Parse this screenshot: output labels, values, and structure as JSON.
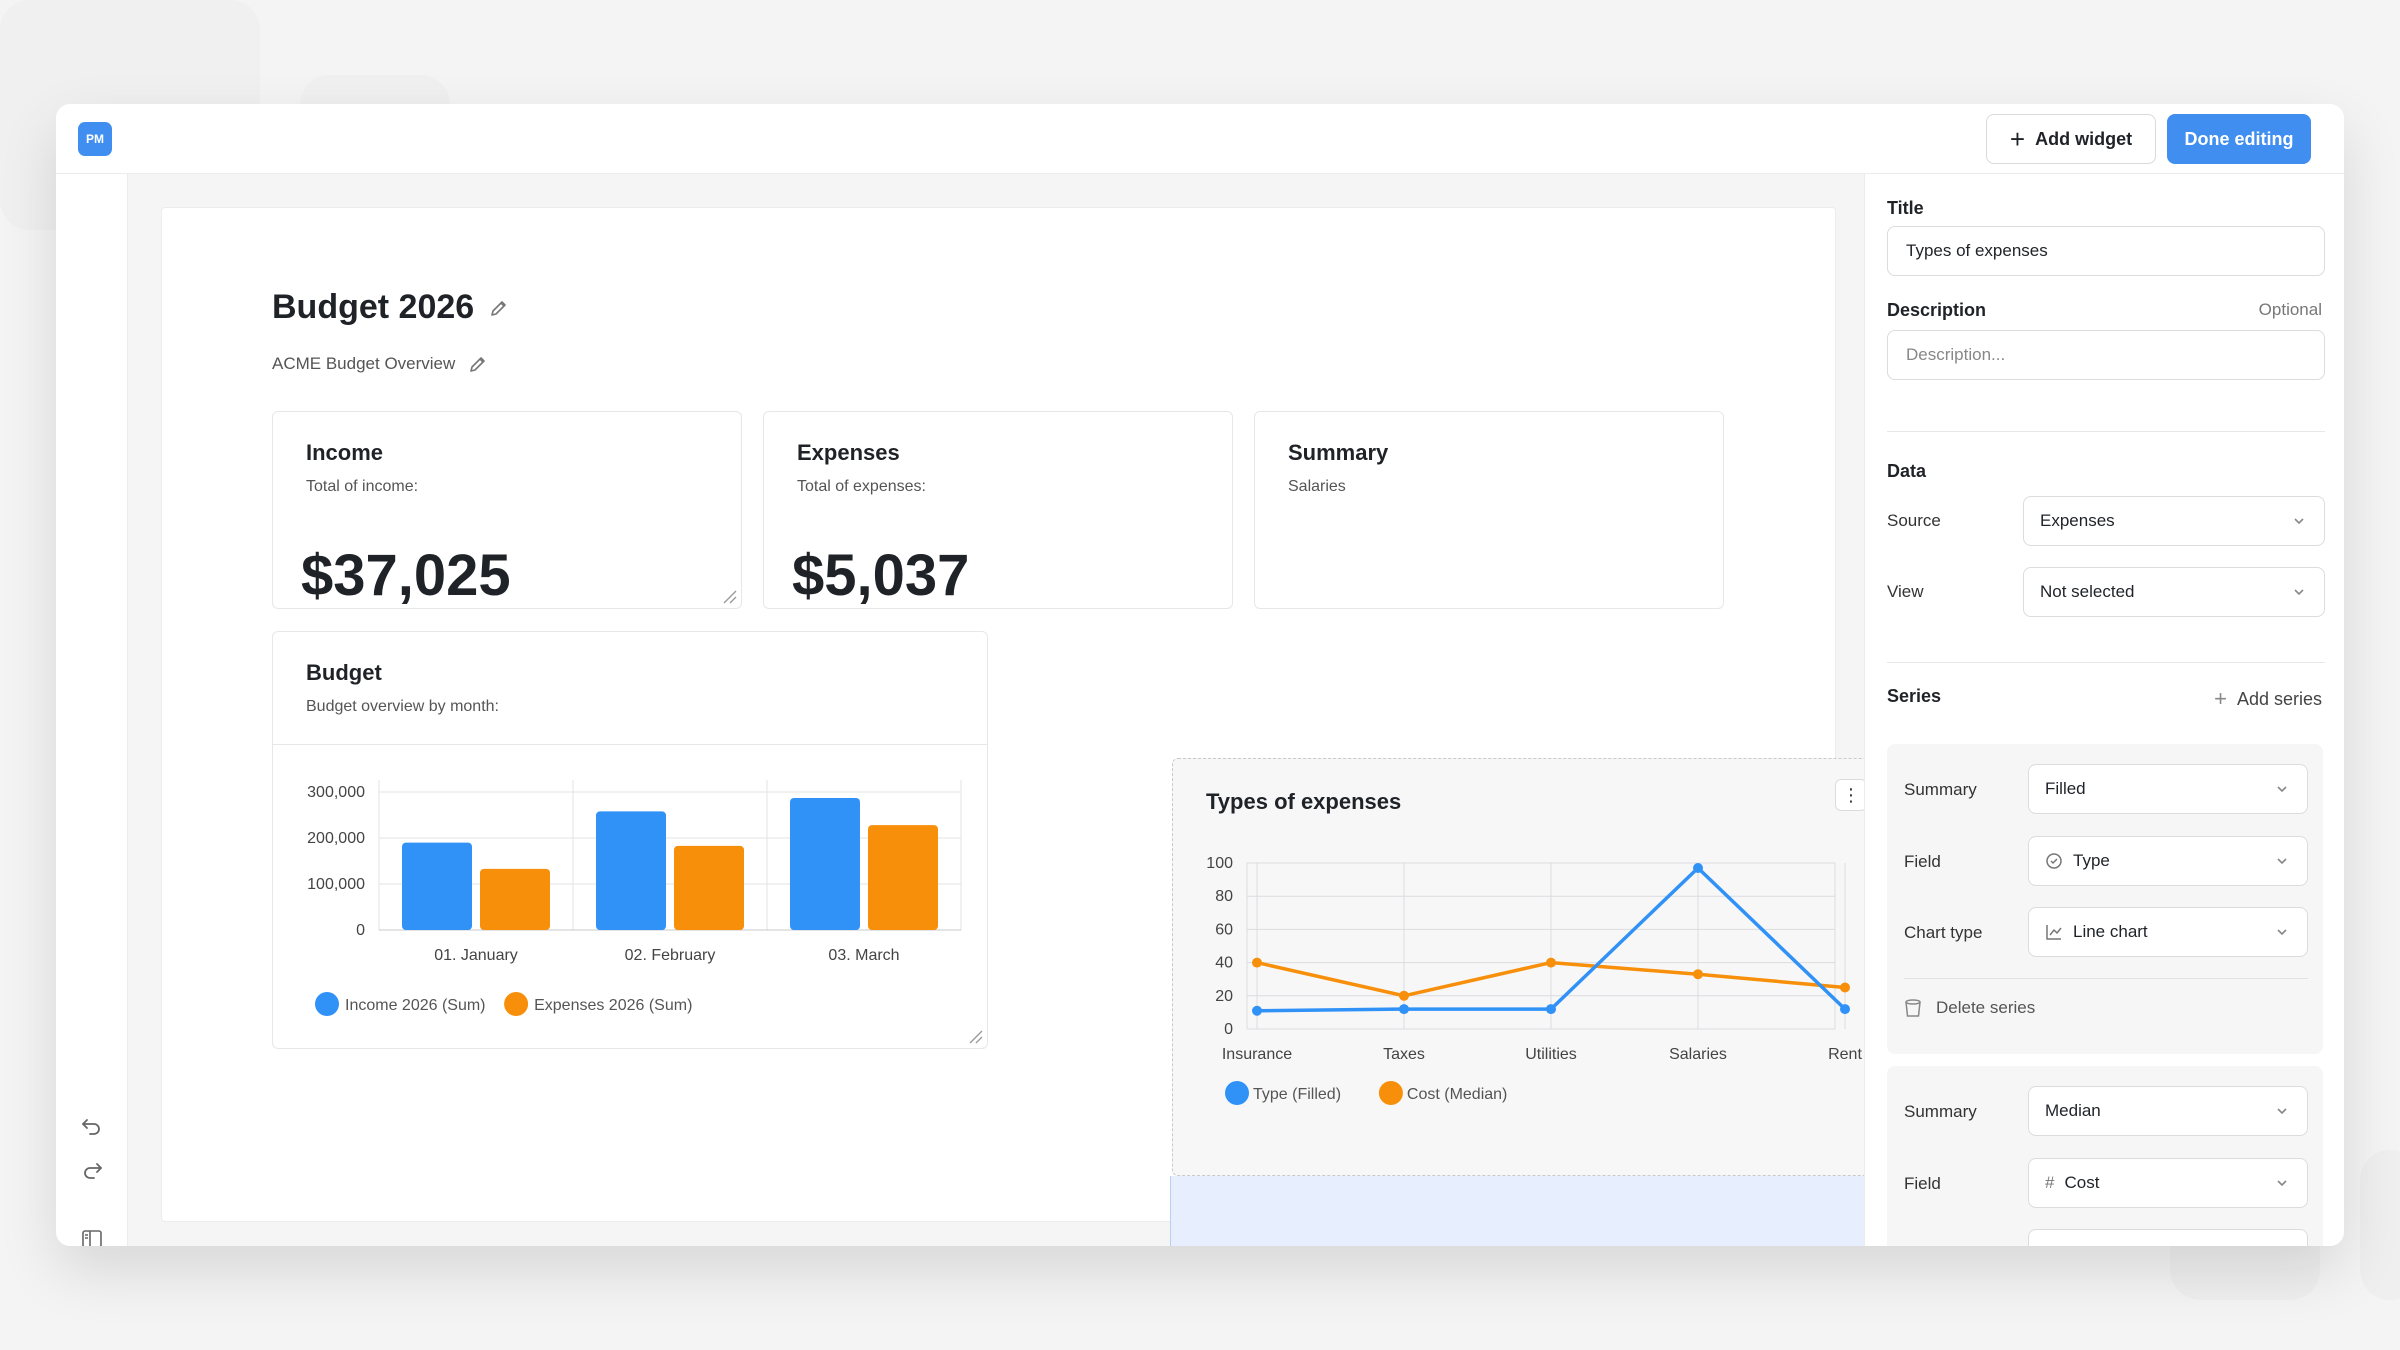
{
  "app": {
    "logo_text": "PM"
  },
  "toolbar": {
    "add_widget_label": "Add widget",
    "done_label": "Done editing",
    "accent": "#3f8ef0"
  },
  "page": {
    "title": "Budget 2026",
    "subtitle": "ACME Budget Overview"
  },
  "cards": {
    "income": {
      "title": "Income",
      "subtitle": "Total of income:",
      "value": "$37,025"
    },
    "expenses": {
      "title": "Expenses",
      "subtitle": "Total of expenses:",
      "value": "$5,037"
    },
    "summary": {
      "title": "Summary",
      "subtitle": "Salaries"
    },
    "budget": {
      "title": "Budget",
      "subtitle": "Budget overview by month:"
    },
    "types": {
      "title": "Types of expenses"
    }
  },
  "chart_data": [
    {
      "type": "bar",
      "categories": [
        "01. January",
        "02. February",
        "03. March"
      ],
      "series": [
        {
          "name": "Income 2026 (Sum)",
          "values": [
            190000,
            258000,
            287000
          ],
          "color": "#3091f7"
        },
        {
          "name": "Expenses 2026 (Sum)",
          "values": [
            133000,
            183000,
            228000
          ],
          "color": "#f78f0a"
        }
      ],
      "yticks": [
        "0",
        "100,000",
        "200,000",
        "300,000"
      ],
      "ylim": [
        0,
        300000
      ],
      "grid": true,
      "legend": "bottom-left"
    },
    {
      "type": "line",
      "categories": [
        "Insurance",
        "Taxes",
        "Utilities",
        "Salaries",
        "Rent"
      ],
      "series": [
        {
          "name": "Type (Filled)",
          "values": [
            11,
            12,
            12,
            97,
            12
          ],
          "color": "#3091f7"
        },
        {
          "name": "Cost (Median)",
          "values": [
            40,
            20,
            40,
            33,
            25
          ],
          "color": "#f78f0a"
        }
      ],
      "yticks": [
        "0",
        "20",
        "40",
        "60",
        "80",
        "100"
      ],
      "ylim": [
        0,
        100
      ],
      "grid": true,
      "legend": "bottom-left"
    }
  ],
  "panel": {
    "title_label": "Title",
    "title_value": "Types of expenses",
    "description_label": "Description",
    "description_optional": "Optional",
    "description_placeholder": "Description...",
    "data_label": "Data",
    "source_label": "Source",
    "source_value": "Expenses",
    "view_label": "View",
    "view_value": "Not selected",
    "series_label": "Series",
    "add_series_label": "Add series",
    "series": [
      {
        "summary_label": "Summary",
        "summary_value": "Filled",
        "field_label": "Field",
        "field_value": "Type",
        "field_icon": "type-field-icon",
        "chart_type_label": "Chart type",
        "chart_type_value": "Line chart",
        "delete_label": "Delete series"
      },
      {
        "summary_label": "Summary",
        "summary_value": "Median",
        "field_label": "Field",
        "field_value": "Cost",
        "field_icon": "number-field-icon"
      }
    ]
  }
}
